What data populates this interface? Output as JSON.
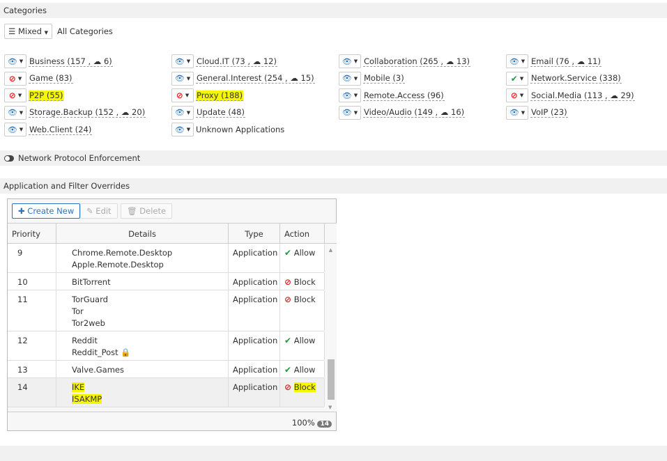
{
  "sections": {
    "categories": "Categories",
    "protocol": "Network Protocol Enforcement",
    "overrides": "Application and Filter Overrides"
  },
  "mixed": {
    "label": "Mixed",
    "all_label": "All Categories"
  },
  "categories": [
    {
      "name": "Business",
      "count": "157",
      "cloud": "6",
      "action": "monitor"
    },
    {
      "name": "Cloud.IT",
      "count": "73",
      "cloud": "12",
      "action": "monitor"
    },
    {
      "name": "Collaboration",
      "count": "265",
      "cloud": "13",
      "action": "monitor"
    },
    {
      "name": "Email",
      "count": "76",
      "cloud": "11",
      "action": "monitor"
    },
    {
      "name": "Game",
      "count": "83",
      "action": "block"
    },
    {
      "name": "General.Interest",
      "count": "254",
      "cloud": "15",
      "action": "monitor"
    },
    {
      "name": "Mobile",
      "count": "3",
      "action": "monitor"
    },
    {
      "name": "Network.Service",
      "count": "338",
      "action": "allow"
    },
    {
      "name": "P2P",
      "count": "55",
      "action": "block",
      "highlighted": true
    },
    {
      "name": "Proxy",
      "count": "188",
      "action": "block",
      "highlighted": true
    },
    {
      "name": "Remote.Access",
      "count": "96",
      "action": "monitor"
    },
    {
      "name": "Social.Media",
      "count": "113",
      "cloud": "29",
      "action": "block"
    },
    {
      "name": "Storage.Backup",
      "count": "152",
      "cloud": "20",
      "action": "monitor"
    },
    {
      "name": "Update",
      "count": "48",
      "action": "monitor"
    },
    {
      "name": "Video/Audio",
      "count": "149",
      "cloud": "16",
      "action": "monitor"
    },
    {
      "name": "VoIP",
      "count": "23",
      "action": "monitor"
    },
    {
      "name": "Web.Client",
      "count": "24",
      "action": "monitor"
    },
    {
      "name": "Unknown Applications",
      "action": "monitor",
      "plain": true
    }
  ],
  "toolbar": {
    "create": "Create New",
    "edit": "Edit",
    "delete": "Delete"
  },
  "table": {
    "headers": [
      "Priority",
      "Details",
      "Type",
      "Action"
    ],
    "rows": [
      {
        "priority": "9",
        "details": [
          "Chrome.Remote.Desktop",
          "Apple.Remote.Desktop"
        ],
        "type": "Application",
        "action": "Allow"
      },
      {
        "priority": "10",
        "details": [
          "BitTorrent"
        ],
        "type": "Application",
        "action": "Block"
      },
      {
        "priority": "11",
        "details": [
          "TorGuard",
          "Tor",
          "Tor2web"
        ],
        "type": "Application",
        "action": "Block"
      },
      {
        "priority": "12",
        "details": [
          "Reddit",
          "Reddit_Post"
        ],
        "locked": [
          false,
          true
        ],
        "type": "Application",
        "action": "Allow"
      },
      {
        "priority": "13",
        "details": [
          "Valve.Games"
        ],
        "type": "Application",
        "action": "Allow"
      },
      {
        "priority": "14",
        "details": [
          "IKE",
          "ISAKMP"
        ],
        "type": "Application",
        "action": "Block",
        "selected": true,
        "highlighted": true
      }
    ]
  },
  "footer": {
    "zoom": "100%",
    "count": "14"
  },
  "colors": {
    "allow": "#1a9a3a",
    "block": "#dd2222",
    "accent": "#2a73c0",
    "highlight": "#f6f600"
  }
}
